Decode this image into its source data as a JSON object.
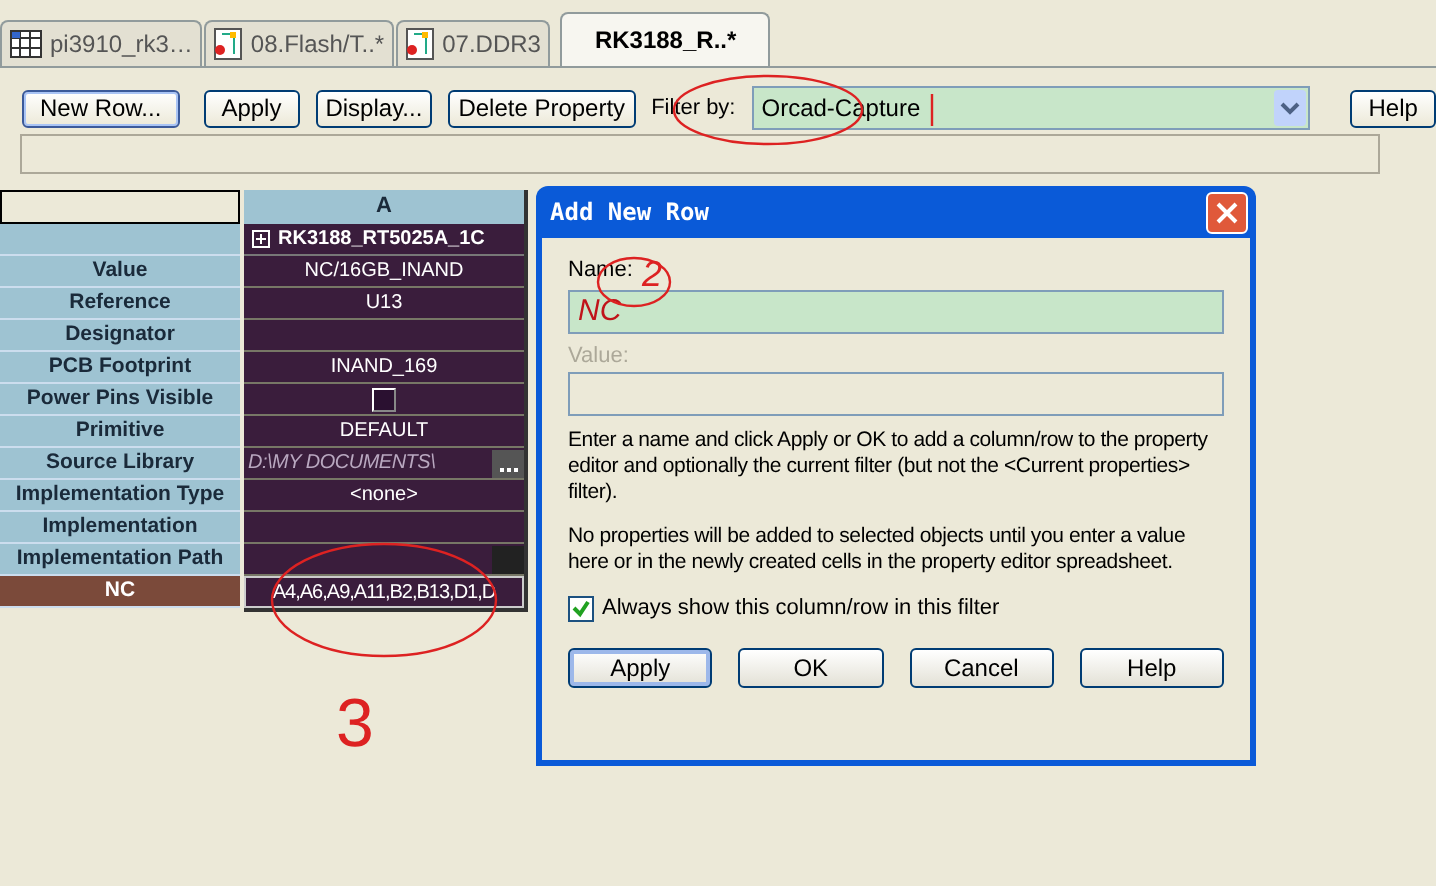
{
  "tabs": [
    {
      "label": "pi3910_rk3…",
      "selected": false,
      "kind": "table"
    },
    {
      "label": "08.Flash/T..*",
      "selected": false,
      "kind": "schematic"
    },
    {
      "label": "07.DDR3",
      "selected": false,
      "kind": "schematic"
    },
    {
      "label": "RK3188_R..*",
      "selected": true,
      "kind": "none"
    }
  ],
  "toolbar": {
    "buttons": [
      "New Row...",
      "Apply",
      "Display...",
      "Delete Property"
    ],
    "filter_label": "Filter by:",
    "filter_value": "Orcad-Capture",
    "help": "Help"
  },
  "grid": {
    "column": "A",
    "part": "RK3188_RT5025A_1C",
    "rows": [
      {
        "label": "Value",
        "value": "NC/16GB_INAND",
        "kind": "text",
        "selected": false
      },
      {
        "label": "Reference",
        "value": "U13",
        "kind": "text",
        "selected": false
      },
      {
        "label": "Designator",
        "value": "",
        "kind": "text",
        "selected": false
      },
      {
        "label": "PCB Footprint",
        "value": "INAND_169",
        "kind": "text",
        "selected": false
      },
      {
        "label": "Power Pins Visible",
        "kind": "checkbox",
        "checked": false,
        "selected": false
      },
      {
        "label": "Primitive",
        "value": "DEFAULT",
        "kind": "text",
        "selected": false
      },
      {
        "label": "Source Library",
        "value": "D:\\MY DOCUMENTS\\",
        "kind": "path",
        "selected": false
      },
      {
        "label": "Implementation Type",
        "value": "<none>",
        "kind": "text",
        "selected": false
      },
      {
        "label": "Implementation",
        "value": "",
        "kind": "text",
        "selected": false
      },
      {
        "label": "Implementation Path",
        "value": "",
        "kind": "browse",
        "selected": false
      },
      {
        "label": "NC",
        "value": "A4,A6,A9,A11,B2,B13,D1,D",
        "kind": "text",
        "selected": true
      }
    ]
  },
  "dialog": {
    "title": "Add New Row",
    "name_label": "Name:",
    "name_value": "NC",
    "value_label": "Value:",
    "value_disabled": true,
    "paragraphs": [
      "Enter a name and click Apply or OK to add a column/row to the property editor and optionally the current filter (but not the <Current properties> filter).",
      "No properties will be added to selected objects until you enter a value here or in the newly created cells in the property editor spreadsheet."
    ],
    "checkbox": {
      "label": "Always show this column/row in this filter",
      "checked": true
    },
    "buttons": [
      {
        "label": "Apply",
        "selected": true
      },
      {
        "label": "OK",
        "selected": false
      },
      {
        "label": "Cancel",
        "selected": false
      },
      {
        "label": "Help",
        "selected": false
      }
    ]
  },
  "annotations": [
    "2",
    "3"
  ]
}
